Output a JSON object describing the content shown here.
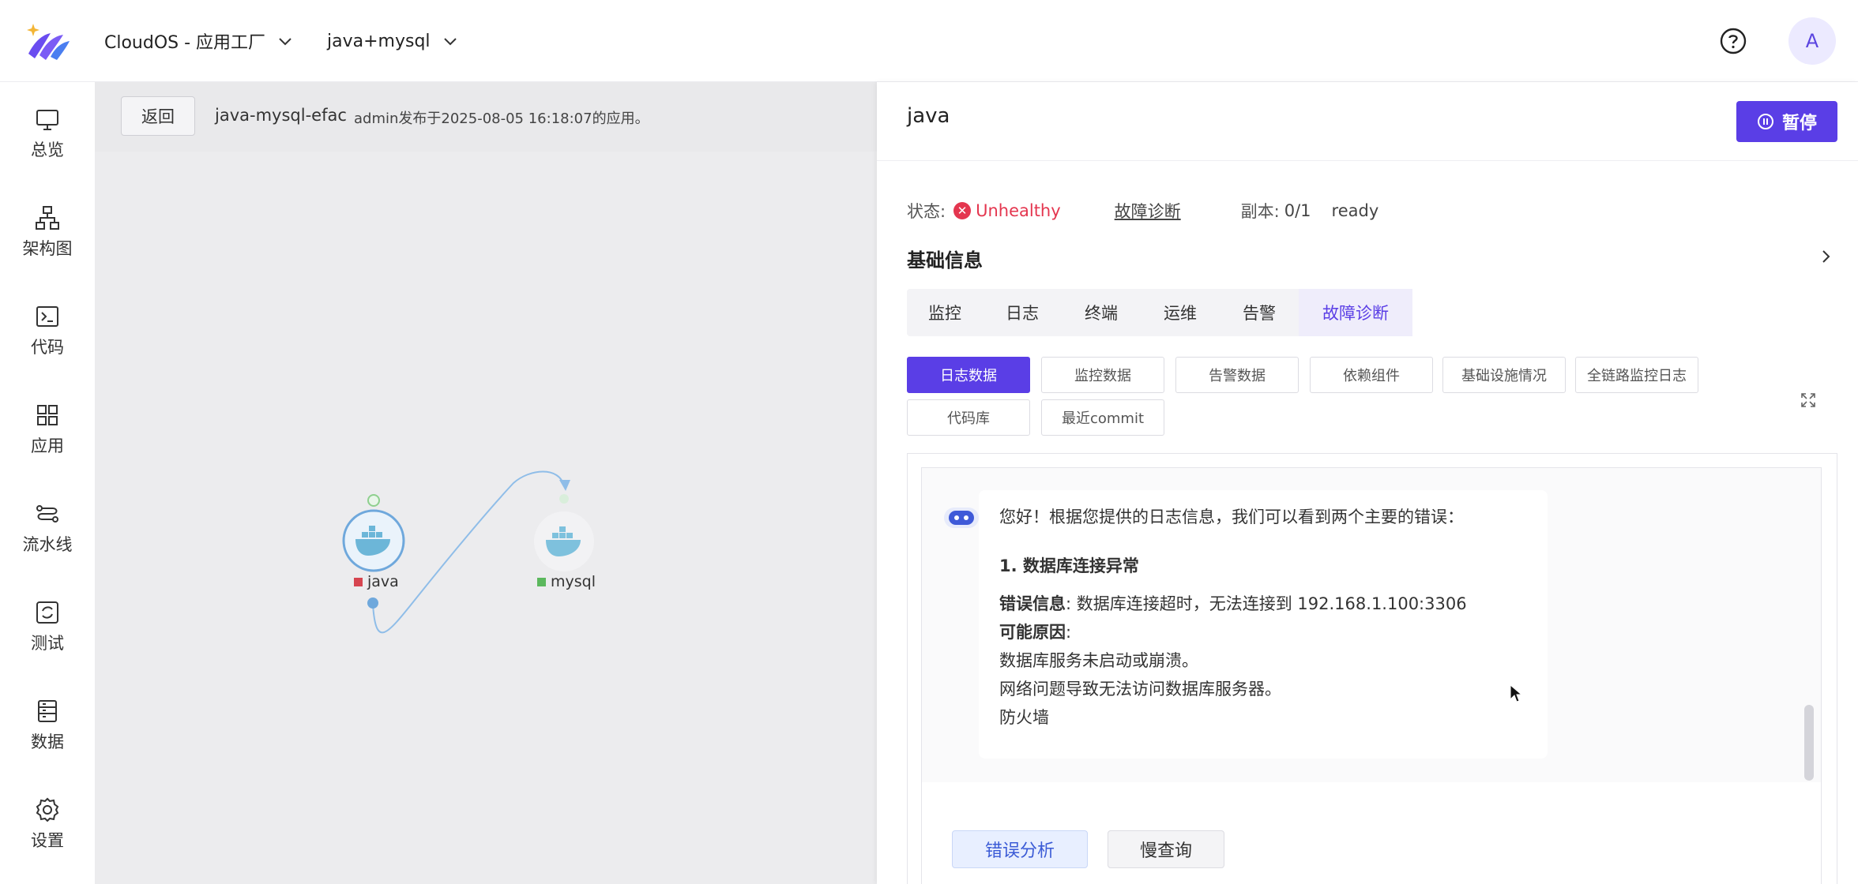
{
  "header": {
    "workspace_selector": "CloudOS - 应用工厂",
    "app_selector": "java+mysql",
    "help_icon": "question-circle-icon",
    "avatar_letter": "A"
  },
  "sidebar": {
    "items": [
      {
        "label": "总览",
        "icon": "monitor-icon"
      },
      {
        "label": "架构图",
        "icon": "hierarchy-icon"
      },
      {
        "label": "代码",
        "icon": "terminal-icon"
      },
      {
        "label": "应用",
        "icon": "grid-icon"
      },
      {
        "label": "流水线",
        "icon": "pipeline-icon"
      },
      {
        "label": "测试",
        "icon": "refresh-box-icon"
      },
      {
        "label": "数据",
        "icon": "database-icon"
      },
      {
        "label": "设置",
        "icon": "gear-icon"
      }
    ]
  },
  "canvas": {
    "back_label": "返回",
    "app_name": "java-mysql-efac",
    "app_meta": "admin发布于2025-08-05 16:18:07的应用。",
    "nodes": [
      {
        "label": "java",
        "status_color": "#d64550",
        "icon": "docker-whale-icon"
      },
      {
        "label": "mysql",
        "status_color": "#5bb85d",
        "icon": "docker-whale-icon"
      }
    ]
  },
  "panel": {
    "title": "java",
    "pause_label": "暂停",
    "status_label": "状态:",
    "status_value": "Unhealthy",
    "diagnose_link": "故障诊断",
    "replica_label": "副本:",
    "replica_value": "0/1",
    "replica_state": "ready",
    "section_title": "基础信息",
    "tabs": [
      "监控",
      "日志",
      "终端",
      "运维",
      "告警",
      "故障诊断"
    ],
    "active_tab": "故障诊断",
    "chips": [
      "日志数据",
      "监控数据",
      "告警数据",
      "依赖组件",
      "基础设施情况",
      "全链路监控日志",
      "代码库",
      "最近commit"
    ],
    "active_chip": "日志数据",
    "message": {
      "intro": "您好！根据您提供的日志信息，我们可以看到两个主要的错误：",
      "heading": "1. 数据库连接异常",
      "error_label": "错误信息",
      "error_text": ": 数据库连接超时，无法连接到 192.168.1.100:3306",
      "cause_label": "可能原因",
      "cause_colon": ":",
      "causes": [
        "数据库服务未启动或崩溃。",
        "网络问题导致无法访问数据库服务器。",
        "防火墙"
      ]
    },
    "actions": [
      "错误分析",
      "慢查询"
    ]
  },
  "colors": {
    "accent": "#5a3ee6",
    "error": "#e4364f",
    "ok": "#5bb85d"
  }
}
